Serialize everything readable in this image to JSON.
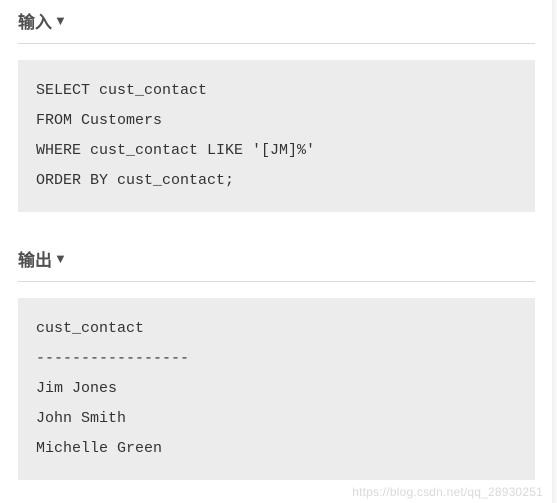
{
  "sections": {
    "input": {
      "title": "输入",
      "arrow": "▼",
      "code": "SELECT cust_contact\nFROM Customers\nWHERE cust_contact LIKE '[JM]%'\nORDER BY cust_contact;"
    },
    "output": {
      "title": "输出",
      "arrow": "▼",
      "code": "cust_contact\n-----------------\nJim Jones\nJohn Smith\nMichelle Green"
    }
  },
  "watermark": "https://blog.csdn.net/qq_28930251"
}
